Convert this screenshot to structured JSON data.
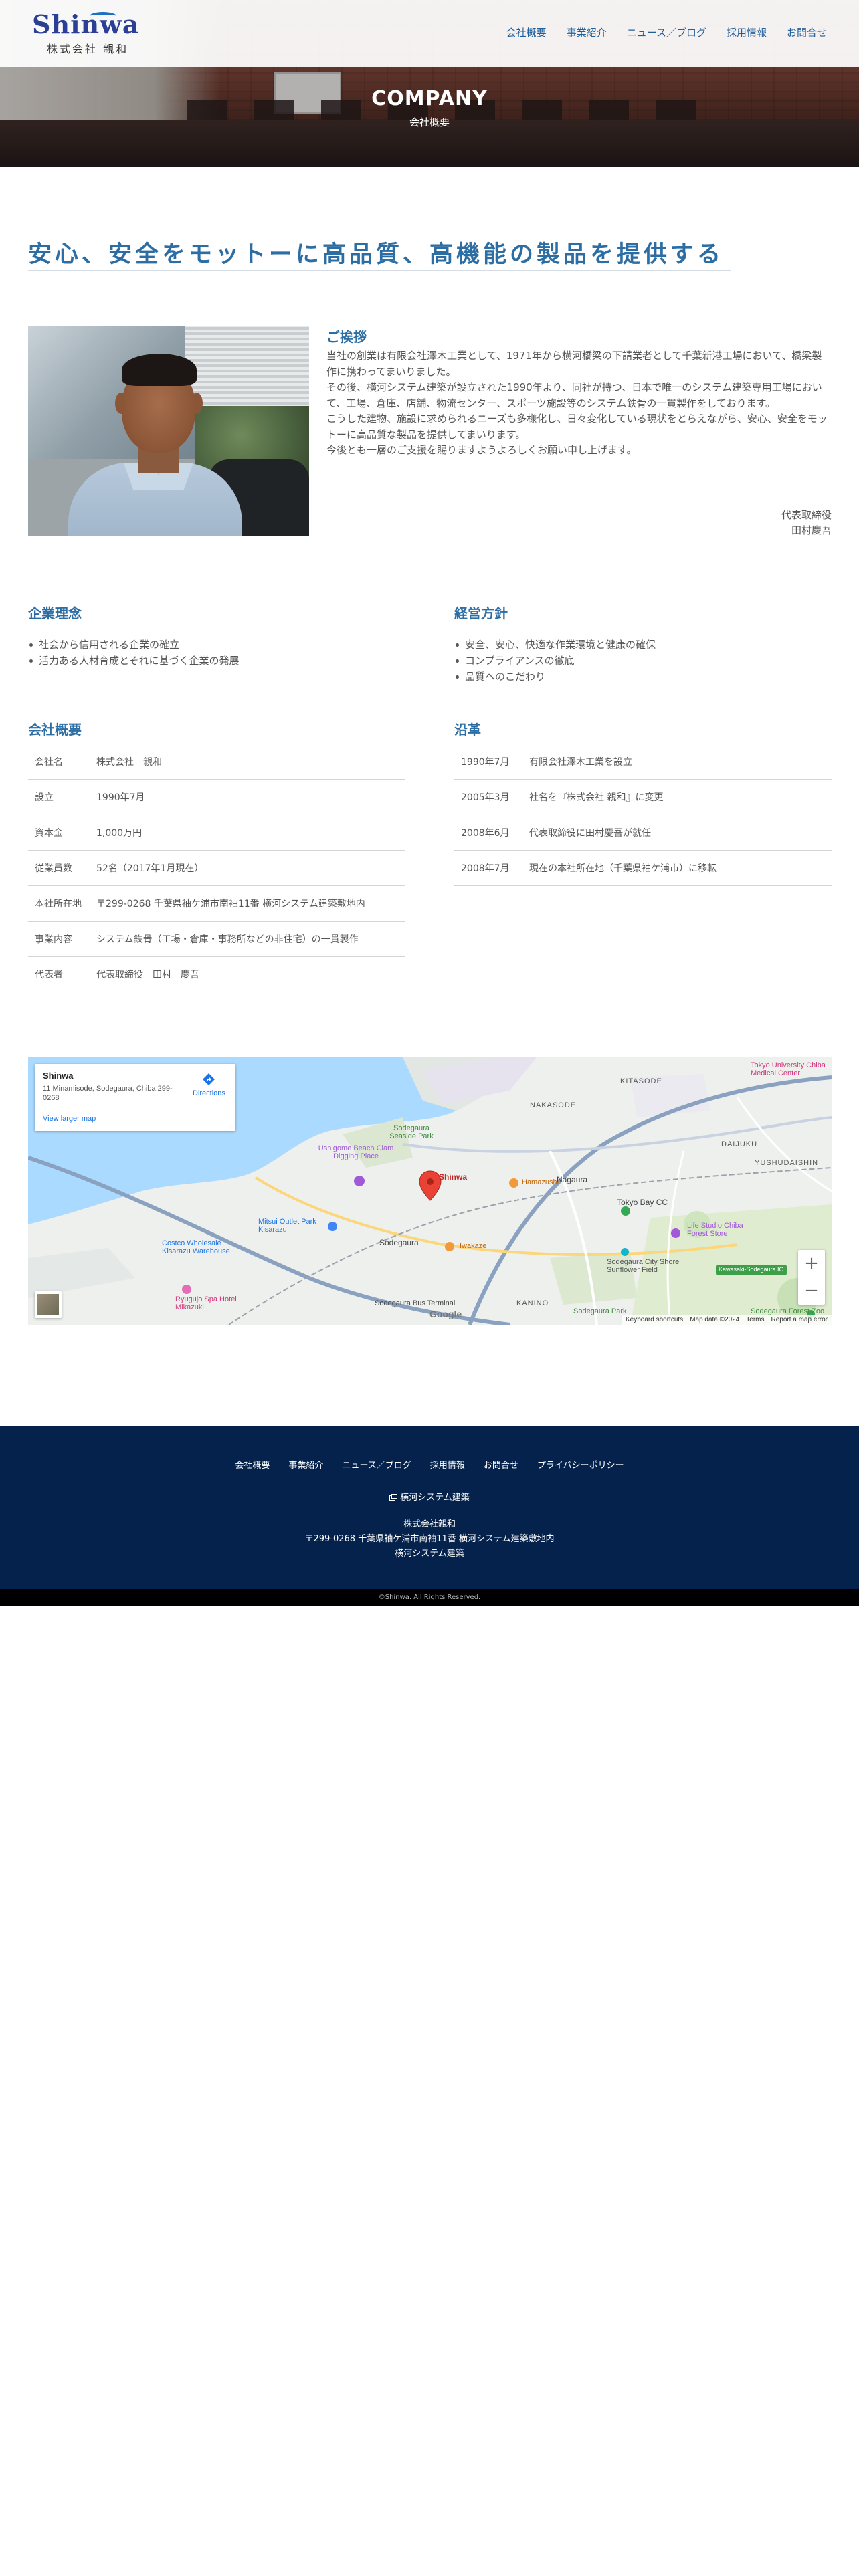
{
  "header": {
    "logo_en": "Shinwa",
    "logo_ja": "株式会社 親和",
    "nav": [
      {
        "label": "会社概要"
      },
      {
        "label": "事業紹介"
      },
      {
        "label": "ニュース／ブログ"
      },
      {
        "label": "採用情報"
      },
      {
        "label": "お問合せ"
      }
    ]
  },
  "hero": {
    "title": "COMPANY",
    "subtitle": "会社概要"
  },
  "catchcopy": "安心、安全をモットーに高品質、高機能の製品を提供する",
  "greeting": {
    "heading": "ご挨拶",
    "paragraphs": [
      "当社の創業は有限会社澤木工業として、1971年から横河橋梁の下請業者として千葉新港工場において、橋梁製作に携わってまいりました。",
      "その後、横河システム建築が設立された1990年より、同社が持つ、日本で唯一のシステム建築専用工場において、工場、倉庫、店舗、物流センター、スポーツ施設等のシステム鉄骨の一貫製作をしております。",
      "こうした建物、施設に求められるニーズも多様化し、日々変化している現状をとらえながら、安心、安全をモットーに高品質な製品を提供してまいります。",
      "今後とも一層のご支援を賜りますようよろしくお願い申し上げます。"
    ],
    "sign_title": "代表取締役",
    "sign_name": "田村慶吾"
  },
  "philosophy": {
    "title": "企業理念",
    "items": [
      "社会から信用される企業の確立",
      "活力ある人材育成とそれに基づく企業の発展"
    ]
  },
  "policy": {
    "title": "経営方針",
    "items": [
      "安全、安心、快適な作業環境と健康の確保",
      "コンプライアンスの徹底",
      "品質へのこだわり"
    ]
  },
  "overview": {
    "title": "会社概要",
    "rows": [
      {
        "label": "会社名",
        "value": "株式会社　親和"
      },
      {
        "label": "設立",
        "value": "1990年7月"
      },
      {
        "label": "資本金",
        "value": "1,000万円"
      },
      {
        "label": "従業員数",
        "value": "52名（2017年1月現在）"
      },
      {
        "label": "本社所在地",
        "value": "〒299-0268 千葉県袖ケ浦市南袖11番 横河システム建築敷地内"
      },
      {
        "label": "事業内容",
        "value": "システム鉄骨（工場・倉庫・事務所などの非住宅）の一貫製作"
      },
      {
        "label": "代表者",
        "value": "代表取締役　田村　慶吾"
      }
    ]
  },
  "history": {
    "title": "沿革",
    "rows": [
      {
        "date": "1990年7月",
        "event": "有限会社澤木工業を設立"
      },
      {
        "date": "2005年3月",
        "event": "社名を『株式会社 親和』に変更"
      },
      {
        "date": "2008年6月",
        "event": "代表取締役に田村慶吾が就任"
      },
      {
        "date": "2008年7月",
        "event": "現在の本社所在地（千葉県袖ケ浦市）に移転"
      }
    ]
  },
  "map": {
    "card_name": "Shinwa",
    "card_address": "11 Minamisode, Sodegaura, Chiba 299-0268",
    "directions": "Directions",
    "larger_map": "View larger map",
    "zoom_in": "+",
    "zoom_out": "−",
    "attribution": [
      "Keyboard shortcuts",
      "Map data ©2024",
      "Terms",
      "Report a map error"
    ],
    "labels": {
      "kitasode": "KITASODE",
      "nakasode": "NAKASODE",
      "daijuku": "DAIJUKU",
      "yushudaishin": "YUSHUDAISHIN",
      "tokyo_univ": "Tokyo University Chiba Medical Center",
      "seaside_park": "Sodegaura Seaside Park",
      "beach": "Ushigome Beach Clam Digging Place",
      "pin": "Shinwa",
      "hamazushi": "Hamazushi",
      "nagaura": "Nagaura",
      "tokyobay_cc": "Tokyo Bay CC",
      "mitsui": "Mitsui Outlet Park Kisarazu",
      "costco": "Costco Wholesale Kisarazu Warehouse",
      "sodegaura": "Sodegaura",
      "iwaizumi": "Iwakaze",
      "lifestudio": "Life Studio Chiba Forest Store",
      "sunflower": "Sodegaura City Shore Sunflower Field",
      "ryugujo": "Ryugujo Spa Hotel Mikazuki",
      "bus_terminal": "Sodegaura Bus Terminal",
      "kanino": "KANINO",
      "forest_zoo": "Sodegaura Forest Zoo",
      "seaside_sodegaura": "Sodegaura Park",
      "google": "Google",
      "road_green": "Kawasaki-Sodegaura IC"
    }
  },
  "footer": {
    "nav": [
      {
        "label": "会社概要"
      },
      {
        "label": "事業紹介"
      },
      {
        "label": "ニュース／ブログ"
      },
      {
        "label": "採用情報"
      },
      {
        "label": "お問合せ"
      },
      {
        "label": "プライバシーポリシー"
      }
    ],
    "link": "横河システム建築",
    "company": "株式会社親和",
    "address": "〒299-0268 千葉県袖ケ浦市南袖11番 横河システム建築敷地内",
    "address2": "横河システム建築",
    "copyright": "©Shinwa. All Rights Reserved."
  },
  "colors": {
    "accent": "#2c6ea4",
    "footer_bg": "#05224c",
    "copyright_bg": "#000000"
  }
}
